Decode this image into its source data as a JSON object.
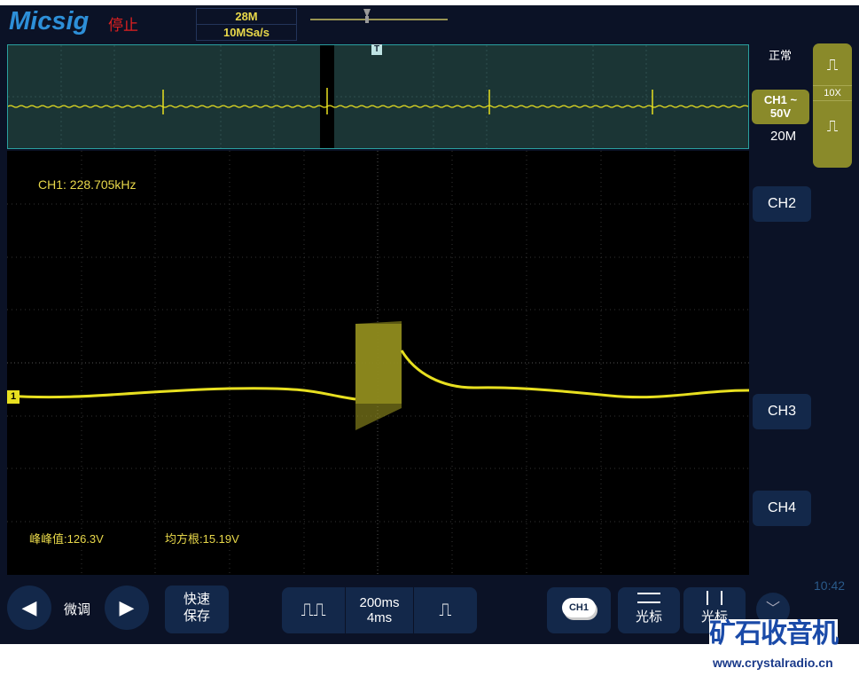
{
  "header": {
    "logo": "Micsig",
    "status": "停止",
    "memory": "28M",
    "sample_rate": "10MSa/s"
  },
  "right_panel": {
    "trigger_mode": "正常",
    "ch1_label": "CH1 ~",
    "ch1_scale": "50V",
    "ch1_bw": "20M",
    "probe": "10X",
    "ch2": "CH2",
    "ch3": "CH3",
    "ch4": "CH4"
  },
  "measurements": {
    "frequency": "CH1: 228.705kHz",
    "peak_to_peak": "峰峰值:126.3V",
    "rms": "均方根:15.19V",
    "channel_marker": "1",
    "trigger_marker": "T"
  },
  "toolbar": {
    "fine_tune": "微调",
    "quick_save_1": "快速",
    "quick_save_2": "保存",
    "timebase": "200ms",
    "timebase2": "4ms",
    "ch1_btn": "CH1",
    "cursor_h": "光标",
    "cursor_v": "光标",
    "time": "10:42"
  },
  "watermark": {
    "title": "矿石收音机",
    "url": "www.crystalradio.cn"
  },
  "colors": {
    "trace": "#e8e020",
    "accent": "#8a8a2a"
  }
}
